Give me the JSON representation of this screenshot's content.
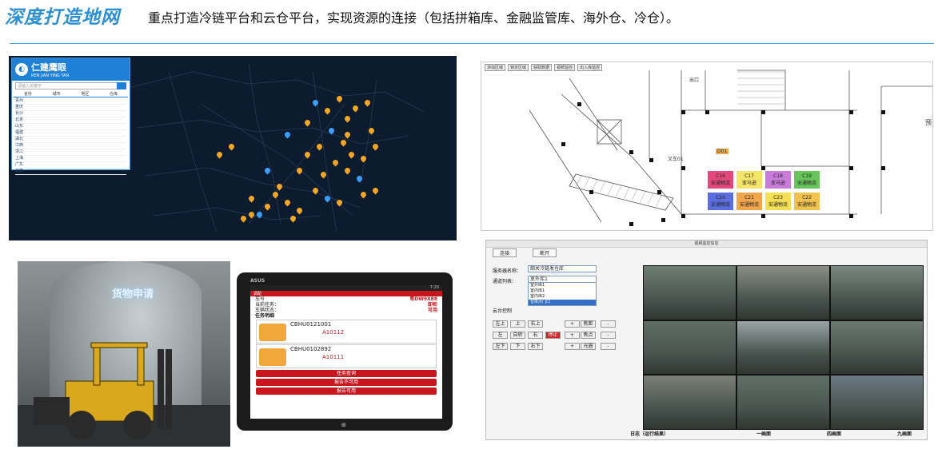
{
  "header": {
    "title": "深度打造地网",
    "subtitle": "重点打造冷链平台和云仓平台，实现资源的连接（包括拼箱库、金融监管库、海外仓、冷仓）。"
  },
  "map_panel": {
    "app_name": "仁建鹰眼",
    "app_name_en": "REN JIAN YING YAN",
    "search_placeholder": "请输入关键字",
    "tabs": [
      "省份",
      "城市",
      "地区",
      "仓库"
    ],
    "list": [
      "贵州",
      "重庆",
      "长沙",
      "北京",
      "山东",
      "福建",
      "湖北",
      "江西",
      "浙江",
      "上海",
      "广东",
      "云南"
    ]
  },
  "plan_panel": {
    "toolbar": [
      "添加区域",
      "锁定区域",
      "获取数据",
      "视频监控",
      "出入库监控"
    ],
    "labels": {
      "exit": "出口",
      "car": "叉车01",
      "mobile_cell": "D01",
      "right": "预"
    },
    "cells": [
      {
        "id": "C16",
        "name": "安通物流",
        "color": "#e4487b"
      },
      {
        "id": "C17",
        "name": "亚马逊",
        "color": "#f5e46a"
      },
      {
        "id": "C18",
        "name": "亚马逊",
        "color": "#c87bd8"
      },
      {
        "id": "C19",
        "name": "安通物流",
        "color": "#66c45a"
      },
      {
        "id": "C20",
        "name": "安通物流",
        "color": "#5b6ee0"
      },
      {
        "id": "C21",
        "name": "安通物流",
        "color": "#f2a64c"
      },
      {
        "id": "C23",
        "name": "安通物流",
        "color": "#f5df52"
      },
      {
        "id": "C22",
        "name": "安通物流",
        "color": "#f2c24e"
      }
    ]
  },
  "fork_panel": {
    "sign": "货物申请"
  },
  "tablet_panel": {
    "brand": "ASUS",
    "time": "7:20",
    "bar_title": "调配",
    "rows": [
      {
        "label": "车号",
        "value": "粤DW9X88"
      },
      {
        "label": "当前任务：",
        "value": "卸柜"
      },
      {
        "label": "车辆状态：",
        "value": "可用"
      }
    ],
    "section": "任务明细",
    "tasks": [
      {
        "code": "CBHU0121001",
        "slot": "A10112"
      },
      {
        "code": "CBHU0102892",
        "slot": "A10111"
      }
    ],
    "buttons": [
      "任务查询",
      "报告不可用",
      "报告可用"
    ]
  },
  "video_panel": {
    "header": "视频监控信息",
    "top_buttons": [
      "连接",
      "断开"
    ],
    "server_label": "服务器名称：",
    "server_value": "韶关冷链发仓库",
    "channel_label": "通道列表：",
    "channel_value": "室外库1",
    "channel_options": [
      "室外库1",
      "室内库1",
      "室内库2",
      "仓库大门口"
    ],
    "ptz_label": "云台控制",
    "ptz": [
      [
        "左上",
        "上",
        "右上",
        "+",
        "焦距",
        "-"
      ],
      [
        "左",
        "自转",
        "右",
        "停止",
        "+",
        "焦点",
        "-"
      ],
      [
        "左下",
        "下",
        "右下",
        "+",
        "光圈",
        "-"
      ]
    ],
    "footer": [
      "日志（运行结果）",
      "一画面",
      "四画面",
      "九画面"
    ]
  }
}
